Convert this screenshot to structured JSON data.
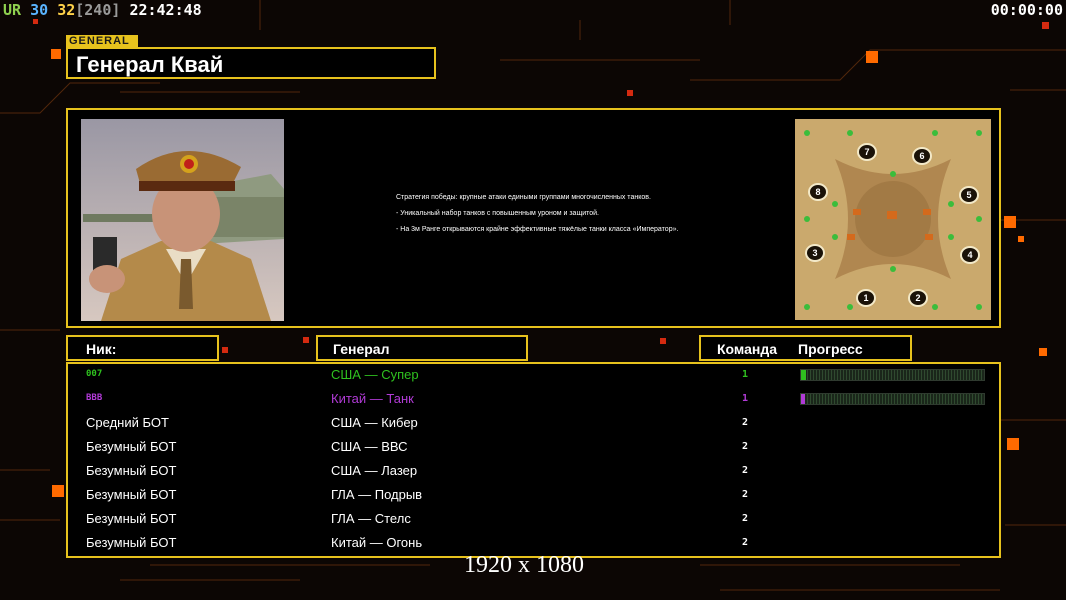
{
  "hud": {
    "ur_label": "UR",
    "fps": "30",
    "gpu": "32",
    "bracket": "[240]",
    "clock": "22:42:48",
    "timer": "00:00:00"
  },
  "general": {
    "tag": "GENERAL",
    "name": "Генерал Квай",
    "description": [
      "Стратегия победы: крупные атаки едиными группами многочисленных танков.",
      "- Уникальный набор танков с повышенным уроном и защитой.",
      "- На 3м Ранге открываются крайне эффективные тяжёлые танки класса «Император»."
    ]
  },
  "headers": {
    "nick": "Ник:",
    "general": "Генерал",
    "team": "Команда",
    "progress": "Прогресс"
  },
  "players": [
    {
      "nick": "007",
      "general": "США — Супер",
      "team": "1",
      "color": "#2fc11f",
      "progress": 0.03
    },
    {
      "nick": "BBB",
      "general": "Китай — Танк",
      "team": "1",
      "color": "#b13bd6",
      "progress": 0.02
    },
    {
      "nick": "Средний БОТ",
      "general": "США — Кибер",
      "team": "2",
      "color": "#ffffff"
    },
    {
      "nick": "Безумный БОТ",
      "general": "США — ВВС",
      "team": "2",
      "color": "#ffffff"
    },
    {
      "nick": "Безумный БОТ",
      "general": "США — Лазер",
      "team": "2",
      "color": "#ffffff"
    },
    {
      "nick": "Безумный БОТ",
      "general": "ГЛА — Подрыв",
      "team": "2",
      "color": "#ffffff"
    },
    {
      "nick": "Безумный БОТ",
      "general": "ГЛА — Стелс",
      "team": "2",
      "color": "#ffffff"
    },
    {
      "nick": "Безумный БОТ",
      "general": "Китай — Огонь",
      "team": "2",
      "color": "#ffffff"
    }
  ],
  "minimap": {
    "slots": [
      "1",
      "2",
      "3",
      "4",
      "5",
      "6",
      "7",
      "8"
    ]
  },
  "footer": {
    "resolution": "1920 x 1080"
  },
  "colors": {
    "accent": "#e7c21d",
    "background": "#0c0604",
    "circuit_lines": "#7a3a10",
    "orange_squares": "#ff6a00",
    "red_squares": "#d42a10"
  }
}
